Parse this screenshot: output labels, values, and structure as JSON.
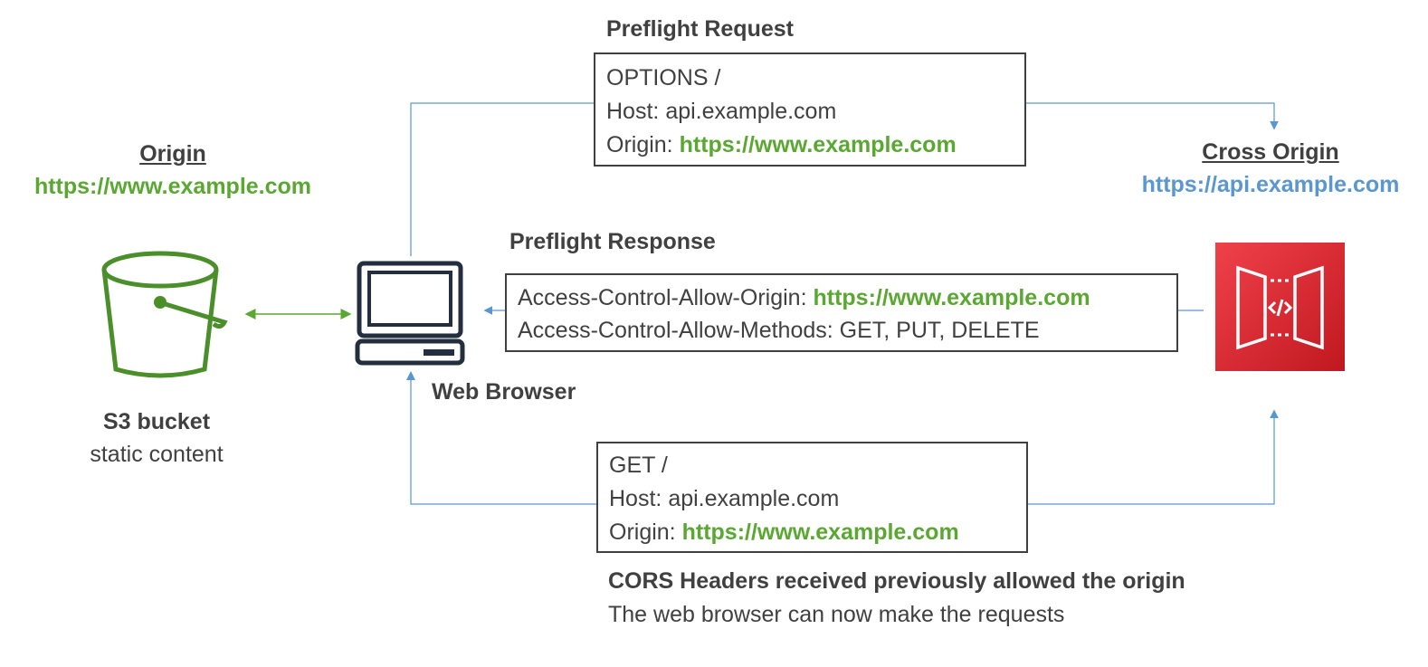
{
  "origin": {
    "title": "Origin",
    "url": "https://www.example.com"
  },
  "cross_origin": {
    "title": "Cross Origin",
    "url": "https://api.example.com"
  },
  "s3": {
    "title": "S3 bucket",
    "subtitle": "static content",
    "icon": "s3-bucket-icon"
  },
  "browser": {
    "label": "Web Browser",
    "icon": "laptop-icon"
  },
  "api": {
    "icon": "api-gateway-icon"
  },
  "preflight_request": {
    "title": "Preflight Request",
    "line1": "OPTIONS /",
    "host_label": "Host:",
    "host_value": "api.example.com",
    "origin_label": "Origin:",
    "origin_value": "https://www.example.com"
  },
  "preflight_response": {
    "title": "Preflight Response",
    "allow_origin_label": "Access-Control-Allow-Origin:",
    "allow_origin_value": "https://www.example.com",
    "allow_methods_label": "Access-Control-Allow-Methods:",
    "allow_methods_value": "GET, PUT, DELETE"
  },
  "get_request": {
    "line1": "GET /",
    "host_label": "Host:",
    "host_value": "api.example.com",
    "origin_label": "Origin:",
    "origin_value": "https://www.example.com"
  },
  "footer": {
    "title": "CORS Headers received previously allowed the origin",
    "subtitle": "The web browser can now make the requests"
  },
  "colors": {
    "green": "#5aa832",
    "blue": "#5a96d0",
    "api_red": "#d6242d",
    "text": "#404040"
  }
}
